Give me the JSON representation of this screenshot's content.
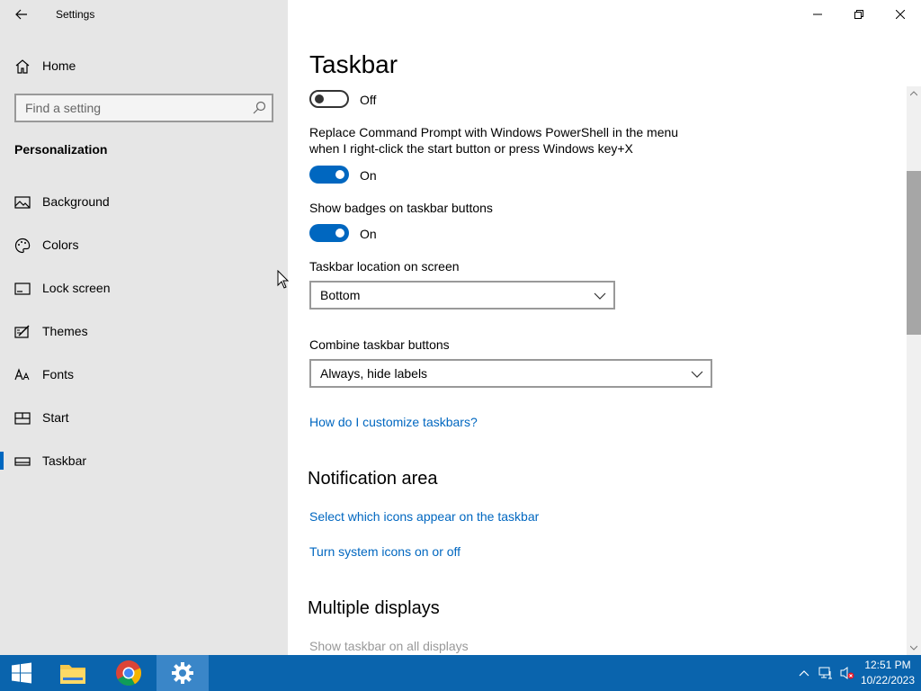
{
  "window": {
    "title": "Settings"
  },
  "sidebar": {
    "home_label": "Home",
    "search_placeholder": "Find a setting",
    "section_title": "Personalization",
    "items": [
      {
        "label": "Background",
        "icon": "image-icon"
      },
      {
        "label": "Colors",
        "icon": "palette-icon"
      },
      {
        "label": "Lock screen",
        "icon": "lock-screen-icon"
      },
      {
        "label": "Themes",
        "icon": "themes-icon"
      },
      {
        "label": "Fonts",
        "icon": "fonts-icon"
      },
      {
        "label": "Start",
        "icon": "start-icon"
      },
      {
        "label": "Taskbar",
        "icon": "taskbar-icon",
        "active": true
      }
    ]
  },
  "main": {
    "title": "Taskbar",
    "toggle1_state": "Off",
    "powershell_desc": "Replace Command Prompt with Windows PowerShell in the menu when I right-click the start button or press Windows key+X",
    "toggle2_state": "On",
    "badges_label": "Show badges on taskbar buttons",
    "toggle3_state": "On",
    "location_label": "Taskbar location on screen",
    "location_value": "Bottom",
    "combine_label": "Combine taskbar buttons",
    "combine_value": "Always, hide labels",
    "customize_link": "How do I customize taskbars?",
    "notification_header": "Notification area",
    "select_icons_link": "Select which icons appear on the taskbar",
    "system_icons_link": "Turn system icons on or off",
    "multiple_displays_header": "Multiple displays",
    "show_all_displays_label": "Show taskbar on all displays"
  },
  "taskbar": {
    "time": "12:51 PM",
    "date": "10/22/2023"
  },
  "colors": {
    "accent": "#0067c0",
    "taskbar": "#0a64ad",
    "sidebar_bg": "#e6e6e6"
  }
}
